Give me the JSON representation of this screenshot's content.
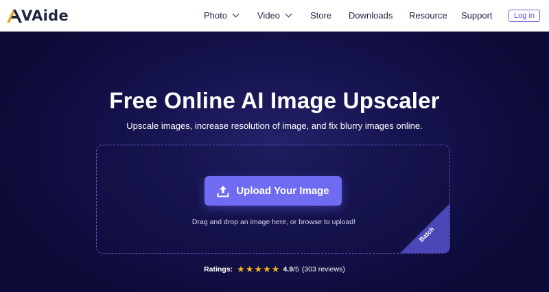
{
  "header": {
    "logo_text": "VAide",
    "nav": [
      {
        "label": "Photo",
        "has_dropdown": true
      },
      {
        "label": "Video",
        "has_dropdown": true
      },
      {
        "label": "Store",
        "has_dropdown": false
      },
      {
        "label": "Downloads",
        "has_dropdown": false
      },
      {
        "label": "Resource",
        "has_dropdown": false
      },
      {
        "label": "Support",
        "has_dropdown": false
      }
    ],
    "login_label": "Log in"
  },
  "hero": {
    "title": "Free Online AI Image Upscaler",
    "subtitle": "Upscale images, increase resolution of image, and fix blurry images online.",
    "upload_label": "Upload Your Image",
    "upload_icon": "upload-icon",
    "drop_hint": "Drag and drop an image here, or browse to upload!",
    "batch_label": "Batch"
  },
  "ratings": {
    "label": "Ratings:",
    "stars": 5,
    "score": "4.9",
    "score_max": "/5",
    "reviews": "(303 reviews)"
  },
  "colors": {
    "accent": "#6f6cf2",
    "background": "#0d0b3a",
    "star": "#f6b21b",
    "text_dark": "#1f2340"
  }
}
